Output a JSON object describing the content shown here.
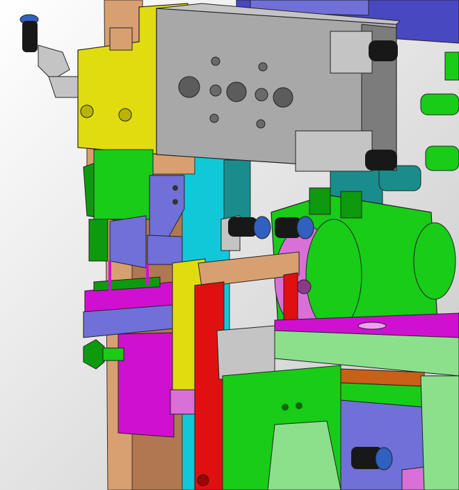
{
  "scene": {
    "background_top": "#ffffff",
    "background_bottom": "#c8c8c8",
    "colors": {
      "yellow": "#e0dc10",
      "gray": "#a8a8a8",
      "gray_dark": "#7c7c7c",
      "gray_light": "#c4c4c4",
      "green": "#18cc18",
      "green_light": "#8ce08c",
      "green_dark": "#0e9a0e",
      "magenta": "#d010d0",
      "purple": "#7070d8",
      "purple_dark": "#4c4cb0",
      "red": "#e01010",
      "tan": "#d8a070",
      "tan_dark": "#b07850",
      "cyan": "#10c8d8",
      "teal": "#1a8c8c",
      "pink": "#d870d8",
      "blue": "#4848c0",
      "black": "#181818",
      "orange": "#c86018"
    }
  }
}
